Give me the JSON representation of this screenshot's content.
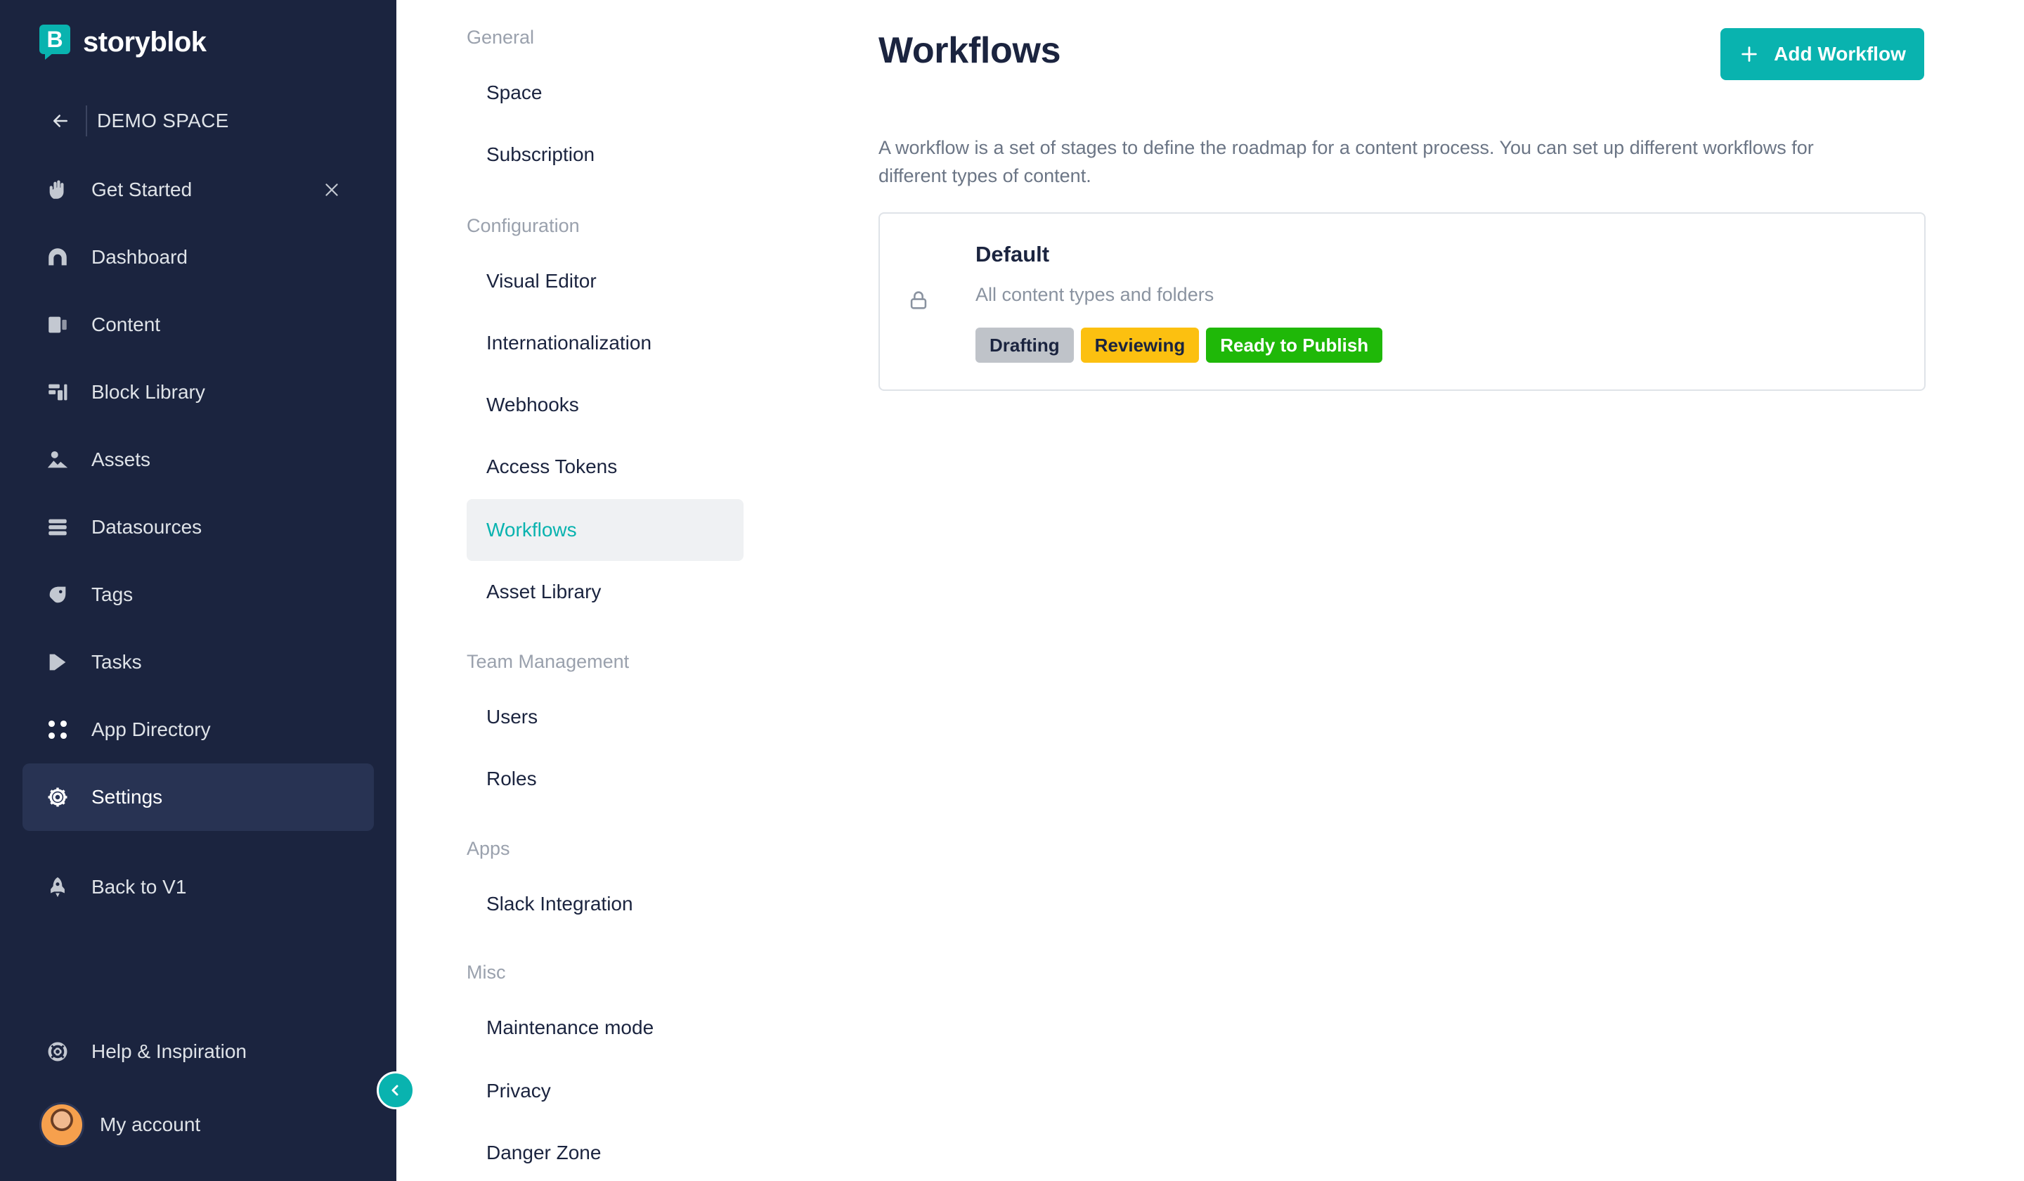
{
  "brand": {
    "logo_letter": "B",
    "name": "storyblok"
  },
  "space": {
    "name": "DEMO SPACE"
  },
  "sidebar": {
    "items": [
      {
        "label": "Get Started",
        "icon": "hand-wave-icon",
        "closable": true
      },
      {
        "label": "Dashboard",
        "icon": "dashboard-icon"
      },
      {
        "label": "Content",
        "icon": "content-icon"
      },
      {
        "label": "Block Library",
        "icon": "block-library-icon"
      },
      {
        "label": "Assets",
        "icon": "assets-icon"
      },
      {
        "label": "Datasources",
        "icon": "datasources-icon"
      },
      {
        "label": "Tags",
        "icon": "tag-icon"
      },
      {
        "label": "Tasks",
        "icon": "tasks-icon"
      },
      {
        "label": "App Directory",
        "icon": "apps-grid-icon"
      },
      {
        "label": "Settings",
        "icon": "gear-icon",
        "active": true
      },
      {
        "label": "Back to V1",
        "icon": "rocket-icon"
      }
    ],
    "help_label": "Help & Inspiration",
    "account_label": "My account"
  },
  "settings_nav": {
    "groups": [
      {
        "title": "General",
        "items": [
          "Space",
          "Subscription"
        ]
      },
      {
        "title": "Configuration",
        "items": [
          "Visual Editor",
          "Internationalization",
          "Webhooks",
          "Access Tokens",
          "Workflows",
          "Asset Library"
        ]
      },
      {
        "title": "Team Management",
        "items": [
          "Users",
          "Roles"
        ]
      },
      {
        "title": "Apps",
        "items": [
          "Slack Integration"
        ]
      },
      {
        "title": "Misc",
        "items": [
          "Maintenance mode",
          "Privacy",
          "Danger Zone"
        ]
      }
    ],
    "active_item": "Workflows"
  },
  "main": {
    "title": "Workflows",
    "add_button_label": "Add Workflow",
    "description": "A workflow is a set of stages to define the roadmap for a content process. You can set up different workflows for different types of content.",
    "workflows": [
      {
        "name": "Default",
        "scope": "All content types and folders",
        "stages": [
          {
            "label": "Drafting",
            "bg": "#bfc3c9",
            "fg": "#1b243f"
          },
          {
            "label": "Reviewing",
            "bg": "#fcc010",
            "fg": "#1b243f"
          },
          {
            "label": "Ready to Publish",
            "bg": "#1fb808",
            "fg": "#ffffff"
          }
        ]
      }
    ]
  },
  "colors": {
    "sidebar_bg": "#1b243f",
    "accent": "#09b3af",
    "active_nav_bg": "#283353",
    "subnav_active_bg": "#eff1f3"
  }
}
